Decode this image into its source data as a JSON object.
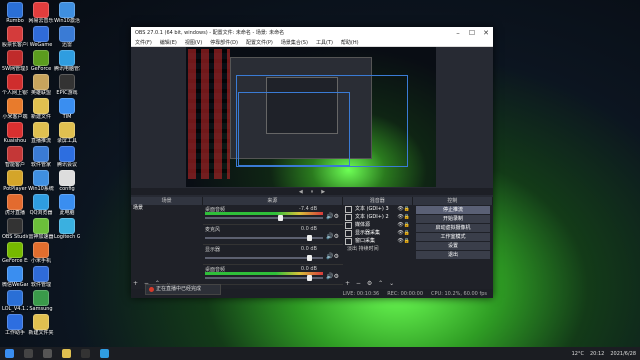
{
  "desktop": {
    "icons": [
      {
        "label": "Rumbo",
        "color": "#2a6fd6"
      },
      {
        "label": "股票长客户端",
        "color": "#d43b3b"
      },
      {
        "label": "5W网管理员",
        "color": "#c02b2b"
      },
      {
        "label": "个人网上银行助手",
        "color": "#cf2d2d"
      },
      {
        "label": "小米客户端",
        "color": "#e87b2c"
      },
      {
        "label": "Kuaishou",
        "color": "#d93030"
      },
      {
        "label": "智能客户",
        "color": "#c43737"
      },
      {
        "label": "PotPlayer",
        "color": "#d4a52a"
      },
      {
        "label": "虎牙直播",
        "color": "#e36b2f"
      },
      {
        "label": "OBS Studio",
        "color": "#333333"
      },
      {
        "label": "GeForce Experience",
        "color": "#76b900"
      },
      {
        "label": "微信WeGame",
        "color": "#3a8ef0"
      },
      {
        "label": "LOL_V4.1.2",
        "color": "#2a6fd6"
      },
      {
        "label": "工作助手",
        "color": "#2d6ee0"
      },
      {
        "label": "网易云音乐",
        "color": "#e23d3d"
      },
      {
        "label": "WeGame",
        "color": "#2f6bd9"
      },
      {
        "label": "GeForce",
        "color": "#5b9c1e"
      },
      {
        "label": "英雄联盟",
        "color": "#c7a45d"
      },
      {
        "label": "新建文件",
        "color": "#e0c050"
      },
      {
        "label": "直播推流",
        "color": "#e0c050"
      },
      {
        "label": "软件管家",
        "color": "#3a7bd5"
      },
      {
        "label": "Win10系统",
        "color": "#3f8fe0"
      },
      {
        "label": "QQ浏览器",
        "color": "#2f9de0"
      },
      {
        "label": "雷神加速器",
        "color": "#6bbf3a"
      },
      {
        "label": "小米手机",
        "color": "#e26e2e"
      },
      {
        "label": "软件管理",
        "color": "#2f6bd9"
      },
      {
        "label": "Samsung",
        "color": "#3a9a4a"
      },
      {
        "label": "新建文件夹",
        "color": "#e0c050"
      },
      {
        "label": "Win10激活",
        "color": "#3f8fe0"
      },
      {
        "label": "迅雷",
        "color": "#3a7bd5"
      },
      {
        "label": "腾讯电脑管家",
        "color": "#2f9de0"
      },
      {
        "label": "EPIC游戏",
        "color": "#333333"
      },
      {
        "label": "TIM",
        "color": "#3a8ef0"
      },
      {
        "label": "录屏工具",
        "color": "#e0c050"
      },
      {
        "label": "腾讯会议",
        "color": "#2d6ee0"
      },
      {
        "label": "config",
        "color": "#dddddd"
      },
      {
        "label": "此电脑",
        "color": "#3a8ef0"
      },
      {
        "label": "Logitech G HUB",
        "color": "#3ab0e0"
      }
    ]
  },
  "obs": {
    "title": "OBS 27.0.1 (64 bit, windows) - 配置文件: 未命名 - 场景: 未命名",
    "menu": [
      "文件(F)",
      "编辑(E)",
      "视图(V)",
      "停靠部件(D)",
      "配置文件(P)",
      "场景集合(S)",
      "工具(T)",
      "帮助(H)"
    ],
    "preview_fps": [
      "◀",
      "⏸",
      "▶"
    ],
    "dock_titles": [
      "场景",
      "混音器",
      "来源",
      "转场",
      "控制"
    ],
    "scenes": [
      "场景"
    ],
    "mixer": [
      {
        "name": "桌面音频",
        "db": "-7.4 dB",
        "level": 0.65
      },
      {
        "name": "麦克风",
        "db": "0.0 dB",
        "level": 0.9
      },
      {
        "name": "显示器",
        "db": "0.0 dB",
        "level": 0.9
      },
      {
        "name": "桌面音频",
        "db": "0.0 dB",
        "level": 0.9
      }
    ],
    "sources": [
      {
        "name": "文本 (GDI+) 3"
      },
      {
        "name": "文本 (GDI+) 2"
      },
      {
        "name": "媒体源"
      },
      {
        "name": "显示器采集"
      },
      {
        "name": "窗口采集"
      }
    ],
    "transitions": [
      "淡出",
      "持续时间"
    ],
    "controls": [
      "停止推流",
      "开始录制",
      "启动虚拟摄像机",
      "工作室模式",
      "设置",
      "退出"
    ],
    "status": [
      "LIVE: 00:10:36",
      "REC: 00:00:00",
      "CPU: 10.2%, 60.00 fps"
    ],
    "notification": "正在直播中已经完成"
  },
  "taskbar": {
    "weather": "12°C",
    "time": "20:12",
    "date": "2021/6/28"
  }
}
